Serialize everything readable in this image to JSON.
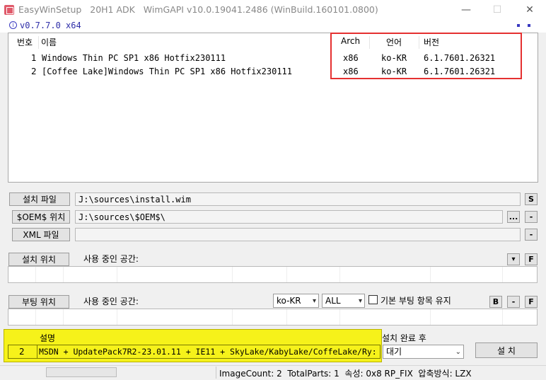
{
  "window": {
    "title": "EasyWinSetup   20H1 ADK   WimGAPI v10.0.19041.2486 (WinBuild.160101.0800)",
    "minimize_glyph": "—",
    "maximize_glyph": "☐",
    "close_glyph": "✕"
  },
  "version": {
    "label": "v0.7.7.0 x64",
    "info_glyph": "i"
  },
  "list": {
    "headers": {
      "num": "번호",
      "name": "이름",
      "arch": "Arch",
      "lang": "언어",
      "ver": "버전"
    },
    "rows": [
      {
        "num": "1",
        "name": "Windows Thin PC SP1 x86 Hotfix230111",
        "arch": "x86",
        "lang": "ko-KR",
        "ver": "6.1.7601.26321"
      },
      {
        "num": "2",
        "name": "[Coffee Lake]Windows Thin PC SP1 x86 Hotfix230111",
        "arch": "x86",
        "lang": "ko-KR",
        "ver": "6.1.7601.26321"
      }
    ]
  },
  "install_file": {
    "button": "설치 파일",
    "path": "J:\\sources\\install.wim",
    "s_button": "S"
  },
  "oem": {
    "button": "$OEM$ 위치",
    "path": "J:\\sources\\$OEM$\\",
    "browse_button": "...",
    "minus_button": "-"
  },
  "xml": {
    "button": "XML 파일",
    "path": "",
    "minus_button": "-"
  },
  "install_location": {
    "button": "설치 위치",
    "space_label": "사용 중인 공간:",
    "dropdown_glyph": "▾",
    "f_button": "F"
  },
  "boot_location": {
    "button": "부팅 위치",
    "space_label": "사용 중인 공간:",
    "lang_select": "ko-KR",
    "scope_select": "ALL",
    "keep_checkbox_label": "기본 부팅 항목 유지",
    "b_button": "B",
    "minus_button": "-",
    "f_button": "F"
  },
  "description": {
    "header": "설명",
    "index": "2",
    "text": "MSDN + UpdatePack7R2-23.01.11 + IE11 + SkyLake/KabyLake/CoffeLake/Ry:"
  },
  "after_install": {
    "label": "설치 완료 후",
    "select": "대기",
    "install_button": "설 치"
  },
  "status": {
    "text": "ImageCount: 2  TotalParts: 1  속성: 0x8 RP_FIX  압축방식: LZX"
  },
  "colors": {
    "highlight": "#f6f21a",
    "redbox": "#e53030",
    "version_text": "#2e2ea8"
  }
}
